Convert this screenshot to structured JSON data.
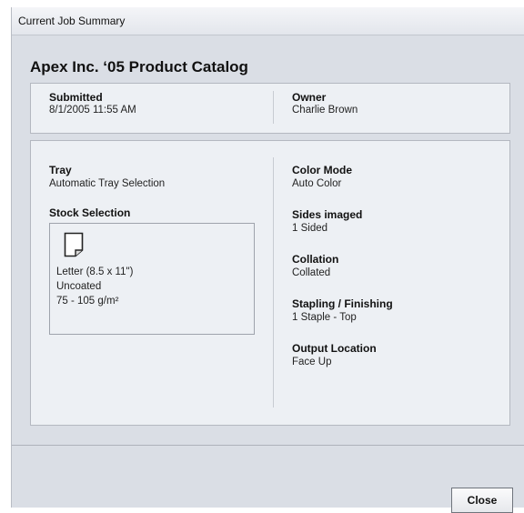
{
  "window": {
    "title": "Current Job Summary"
  },
  "job": {
    "name": "Apex Inc. ‘05 Product Catalog"
  },
  "submission": {
    "submitted_label": "Submitted",
    "submitted_value": "8/1/2005 11:55 AM",
    "owner_label": "Owner",
    "owner_value": "Charlie Brown"
  },
  "details": {
    "tray_label": "Tray",
    "tray_value": "Automatic Tray Selection",
    "stock_label": "Stock Selection",
    "stock": {
      "icon": "paper-sheet-icon",
      "size": "Letter (8.5 x 11\")",
      "coating": "Uncoated",
      "weight": "75 - 105 g/m²"
    },
    "color_mode_label": "Color Mode",
    "color_mode_value": "Auto Color",
    "sides_label": "Sides imaged",
    "sides_value": "1 Sided",
    "collation_label": "Collation",
    "collation_value": "Collated",
    "stapling_label": "Stapling / Finishing",
    "stapling_value": "1 Staple - Top",
    "output_label": "Output Location",
    "output_value": "Face Up"
  },
  "footer": {
    "close_label": "Close"
  }
}
